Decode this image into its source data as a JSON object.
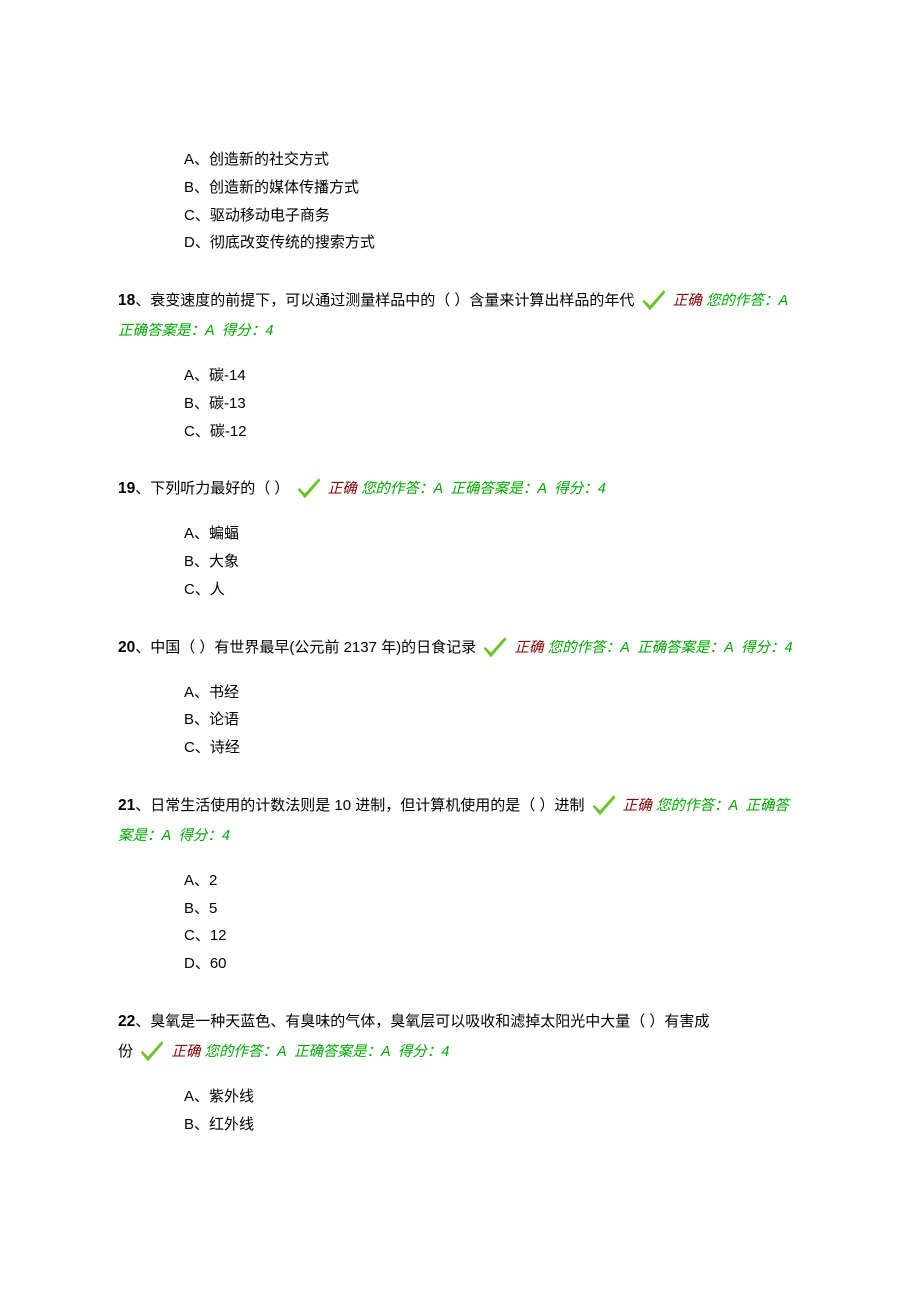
{
  "labels": {
    "correct": "正确",
    "your_answer_prefix": "您的作答：",
    "correct_answer_prefix": "正确答案是：",
    "score_prefix": "得分：",
    "score_value": "4"
  },
  "q17": {
    "options": {
      "a": "A、创造新的社交方式",
      "b": "B、创造新的媒体传播方式",
      "c": "C、驱动移动电子商务",
      "d": "D、彻底改变传统的搜索方式"
    }
  },
  "q18": {
    "num": "18",
    "text": "、衰变速度的前提下，可以通过测量样品中的（ ）含量来计算出样品的年代",
    "your": "A",
    "correct": "A",
    "options": {
      "a": "A、碳-14",
      "b": "B、碳-13",
      "c": "C、碳-12"
    }
  },
  "q19": {
    "num": "19",
    "text": "、下列听力最好的（ ）",
    "your": "A",
    "correct": "A",
    "options": {
      "a": "A、蝙蝠",
      "b": "B、大象",
      "c": "C、人"
    }
  },
  "q20": {
    "num": "20",
    "text": "、中国（ ）有世界最早(公元前 2137 年)的日食记录",
    "your": "A",
    "correct": "A",
    "options": {
      "a": "A、书经",
      "b": "B、论语",
      "c": "C、诗经"
    }
  },
  "q21": {
    "num": "21",
    "text": "、日常生活使用的计数法则是 10 进制，但计算机使用的是（ ）进制",
    "your": "A",
    "correct": "A",
    "options": {
      "a": "A、2",
      "b": "B、5",
      "c": "C、12",
      "d": "D、60"
    }
  },
  "q22": {
    "num": "22",
    "text_a": "、臭氧是一种天蓝色、有臭味的气体，臭氧层可以吸收和滤掉太阳光中大量（ ）有害成",
    "text_b": "份",
    "your": "A",
    "correct": "A",
    "options": {
      "a": "A、紫外线",
      "b": "B、红外线"
    }
  }
}
